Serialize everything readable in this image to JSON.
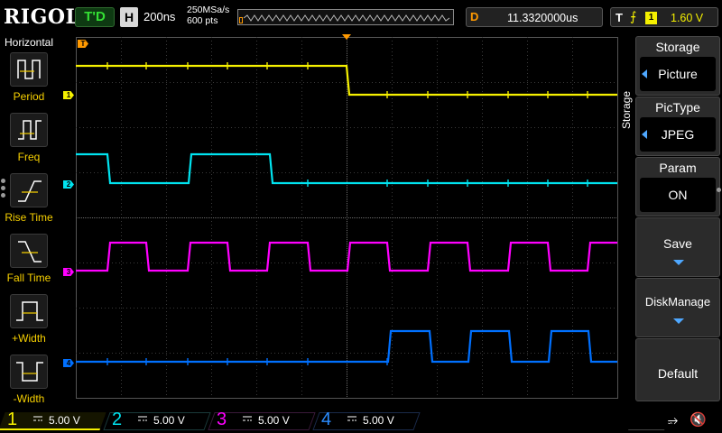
{
  "brand": "RIGOL",
  "topbar": {
    "run_mode": "T'D",
    "horizontal_badge": "H",
    "timebase": "200ns",
    "sample_rate": "250MSa/s",
    "memory_depth": "600 pts",
    "delay_badge": "D",
    "delay_value": "11.3320000us",
    "trigger_badge": "T",
    "trigger_edge": "rising-edge-icon",
    "trigger_source": "1",
    "trigger_level": "1.60 V"
  },
  "left_panel": {
    "title": "Horizontal",
    "items": [
      {
        "label": "Period",
        "icon": "period-icon"
      },
      {
        "label": "Freq",
        "icon": "freq-icon"
      },
      {
        "label": "Rise Time",
        "icon": "rise-time-icon"
      },
      {
        "label": "Fall Time",
        "icon": "fall-time-icon"
      },
      {
        "label": "+Width",
        "icon": "positive-width-icon"
      },
      {
        "label": "-Width",
        "icon": "negative-width-icon"
      }
    ]
  },
  "right_panel": {
    "side_label": "Storage",
    "buttons": [
      {
        "caption": "Storage",
        "value": "Picture"
      },
      {
        "caption": "PicType",
        "value": "JPEG"
      },
      {
        "caption": "Param",
        "value": "ON"
      },
      {
        "caption": "Save"
      },
      {
        "caption": "DiskManage"
      },
      {
        "caption": "Default"
      }
    ]
  },
  "channels": [
    {
      "number": "1",
      "scale": "5.00 V",
      "color": "#f5f000"
    },
    {
      "number": "2",
      "scale": "5.00 V",
      "color": "#00e4f0"
    },
    {
      "number": "3",
      "scale": "5.00 V",
      "color": "#ff00ff"
    },
    {
      "number": "4",
      "scale": "5.00 V",
      "color": "#0070ff"
    }
  ],
  "markers": {
    "trigger_level_marker": "T",
    "ch_markers": [
      "1",
      "2",
      "3",
      "4"
    ]
  },
  "status": {
    "usb_icon": "usb-icon",
    "speaker_icon": "speaker-muted-icon"
  }
}
